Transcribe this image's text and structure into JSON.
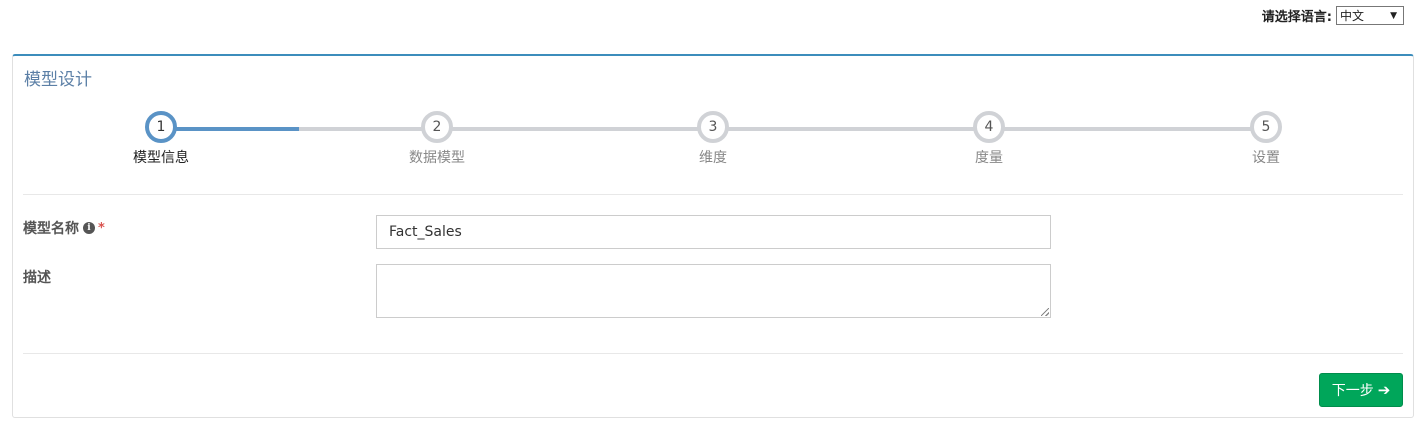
{
  "language": {
    "label": "请选择语言:",
    "selected": "中文"
  },
  "panel": {
    "title": "模型设计"
  },
  "steps": [
    {
      "number": "1",
      "label": "模型信息",
      "active": true
    },
    {
      "number": "2",
      "label": "数据模型",
      "active": false
    },
    {
      "number": "3",
      "label": "维度",
      "active": false
    },
    {
      "number": "4",
      "label": "度量",
      "active": false
    },
    {
      "number": "5",
      "label": "设置",
      "active": false
    }
  ],
  "form": {
    "model_name_label": "模型名称",
    "required_mark": "*",
    "model_name_value": "Fact_Sales",
    "description_label": "描述",
    "description_value": ""
  },
  "actions": {
    "next_label": "下一步"
  },
  "colors": {
    "accent": "#5a93c6",
    "panel_border": "#3c8dbc",
    "next_button": "#00a65a",
    "required": "#d9534f"
  },
  "icons": {
    "info": "info-circle-icon",
    "next": "arrow-right-icon",
    "dropdown": "caret-down-icon"
  }
}
